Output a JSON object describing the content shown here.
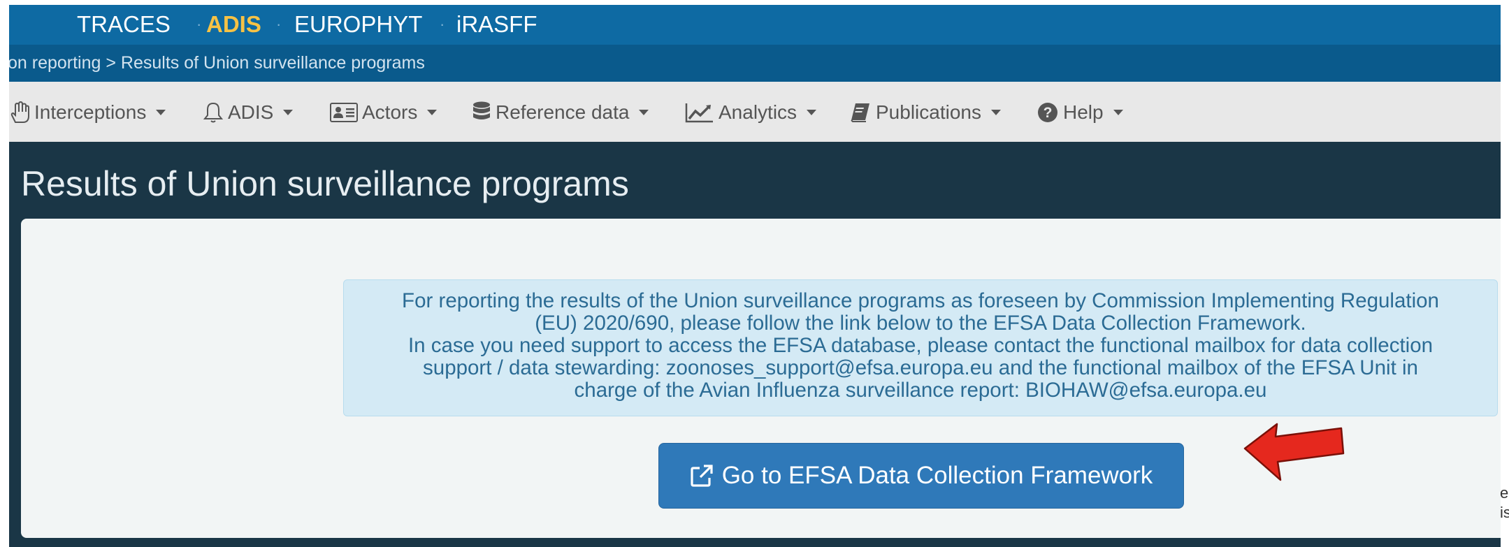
{
  "brands": [
    {
      "label": "TRACES",
      "active": false
    },
    {
      "label": "ADIS",
      "active": true
    },
    {
      "label": "EUROPHYT",
      "active": false
    },
    {
      "label": "iRASFF",
      "active": false
    }
  ],
  "breadcrumb": "on reporting > Results of Union surveillance programs",
  "menu": [
    {
      "label": "Interceptions",
      "icon": "hand-icon"
    },
    {
      "label": "ADIS",
      "icon": "bell-icon"
    },
    {
      "label": "Actors",
      "icon": "id-card-icon"
    },
    {
      "label": "Reference data",
      "icon": "database-icon"
    },
    {
      "label": "Analytics",
      "icon": "line-chart-icon"
    },
    {
      "label": "Publications",
      "icon": "book-icon"
    },
    {
      "label": "Help",
      "icon": "question-circle-icon"
    }
  ],
  "page_title": "Results of Union surveillance programs",
  "alert_lines": [
    "For reporting the results of the Union surveillance programs as foreseen by Commission Implementing Regulation",
    "(EU) 2020/690, please follow the link below to the EFSA Data Collection Framework.",
    "In case you need support to access the EFSA database, please contact the functional mailbox for data collection",
    "support / data stewarding: zoonoses_support@efsa.europa.eu and the functional mailbox of the EFSA Unit in",
    "charge of the Avian Influenza surveillance report: BIOHAW@efsa.europa.eu"
  ],
  "efsa_button": {
    "label": "Go to EFSA Data Collection Framework",
    "icon": "external-link-icon"
  },
  "annotation": {
    "icon": "red-arrow-icon",
    "color": "#e5281e"
  },
  "edge_text": [
    "ea",
    "is"
  ],
  "colors": {
    "brandbar": "#0e6aa3",
    "active_brand": "#f6c245",
    "page_background": "#1a3646",
    "button": "#2f79b9",
    "alert_background": "#d4eaf5"
  }
}
